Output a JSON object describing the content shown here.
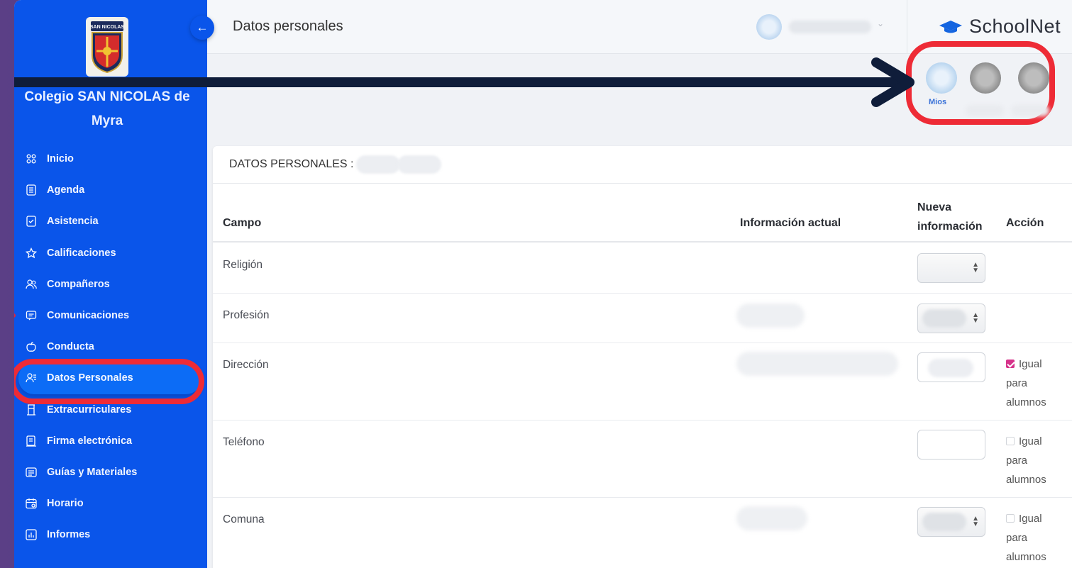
{
  "sidebar": {
    "school_name": "Colegio SAN NICOLAS de Myra",
    "items": [
      {
        "label": "Inicio",
        "icon": "grid-icon"
      },
      {
        "label": "Agenda",
        "icon": "agenda-icon"
      },
      {
        "label": "Asistencia",
        "icon": "attendance-icon"
      },
      {
        "label": "Calificaciones",
        "icon": "star-icon"
      },
      {
        "label": "Compañeros",
        "icon": "users-icon"
      },
      {
        "label": "Comunicaciones",
        "icon": "message-icon"
      },
      {
        "label": "Conducta",
        "icon": "apple-icon"
      },
      {
        "label": "Datos Personales",
        "icon": "user-list-icon",
        "active": true
      },
      {
        "label": "Extracurriculares",
        "icon": "tower-icon"
      },
      {
        "label": "Firma electrónica",
        "icon": "signature-icon"
      },
      {
        "label": "Guías y Materiales",
        "icon": "folder-icon"
      },
      {
        "label": "Horario",
        "icon": "calendar-icon"
      },
      {
        "label": "Informes",
        "icon": "report-icon"
      }
    ]
  },
  "header": {
    "title": "Datos personales",
    "brand": "SchoolNet",
    "collapse_icon": "arrow-left-icon"
  },
  "children": {
    "mine_label": "Mios"
  },
  "card": {
    "title": "DATOS PERSONALES :",
    "columns": {
      "campo": "Campo",
      "actual": "Información actual",
      "nueva_line1": "Nueva",
      "nueva_line2": "información",
      "accion": "Acción"
    },
    "rows": [
      {
        "field": "Religión",
        "input": "select",
        "action": null
      },
      {
        "field": "Profesión",
        "input": "select",
        "action": null
      },
      {
        "field": "Dirección",
        "input": "text",
        "action": {
          "checked": true,
          "line1": "Igual",
          "line2": "para",
          "line3": "alumnos"
        }
      },
      {
        "field": "Teléfono",
        "input": "text",
        "action": {
          "checked": false,
          "line1": "Igual",
          "line2": "para",
          "line3": "alumnos"
        }
      },
      {
        "field": "Comuna",
        "input": "select",
        "action": {
          "checked": false,
          "line1": "Igual",
          "line2": "para",
          "line3": "alumnos"
        }
      }
    ]
  },
  "colors": {
    "sidebar": "#0a55ea",
    "highlight": "#ee2b36",
    "arrow": "#0f1d3a",
    "checkbox_checked": "#d6328a"
  }
}
